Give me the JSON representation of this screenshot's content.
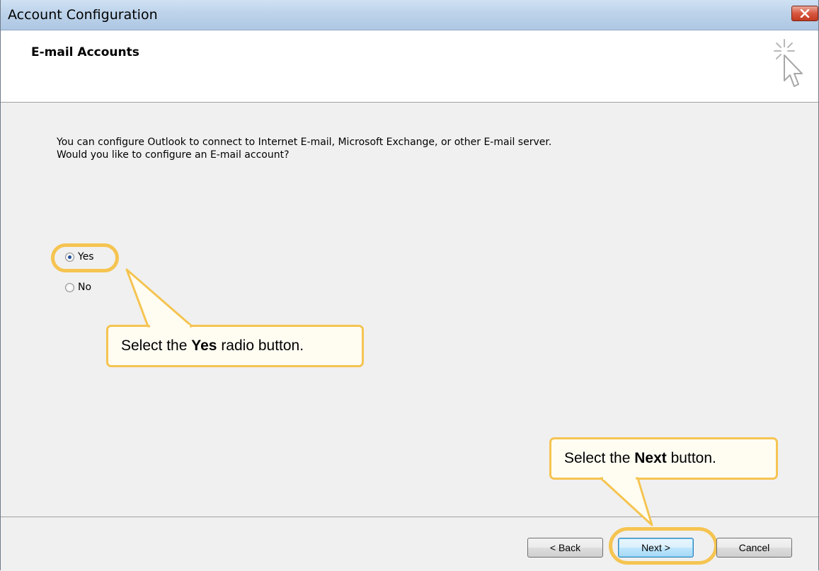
{
  "window": {
    "title": "Account Configuration",
    "close_icon": "close-icon"
  },
  "header": {
    "title": "E-mail Accounts",
    "icon": "cursor-sparkle-icon"
  },
  "body": {
    "question": "You can configure Outlook to connect to Internet E-mail, Microsoft Exchange, or other E-mail server. Would you like to configure an E-mail account?",
    "options": [
      {
        "label": "Yes",
        "selected": true
      },
      {
        "label": "No",
        "selected": false
      }
    ]
  },
  "callouts": {
    "yes": {
      "prefix": "Select the ",
      "bold": "Yes",
      "suffix": " radio button."
    },
    "next": {
      "prefix": "Select the ",
      "bold": "Next",
      "suffix": " button."
    }
  },
  "footer": {
    "back_label": "< Back",
    "next_label": "Next >",
    "cancel_label": "Cancel"
  },
  "colors": {
    "highlight": "#f5c451",
    "callout_bg": "#fffdf2",
    "titlebar": "#bdd3ea",
    "close_button": "#d9573f"
  }
}
